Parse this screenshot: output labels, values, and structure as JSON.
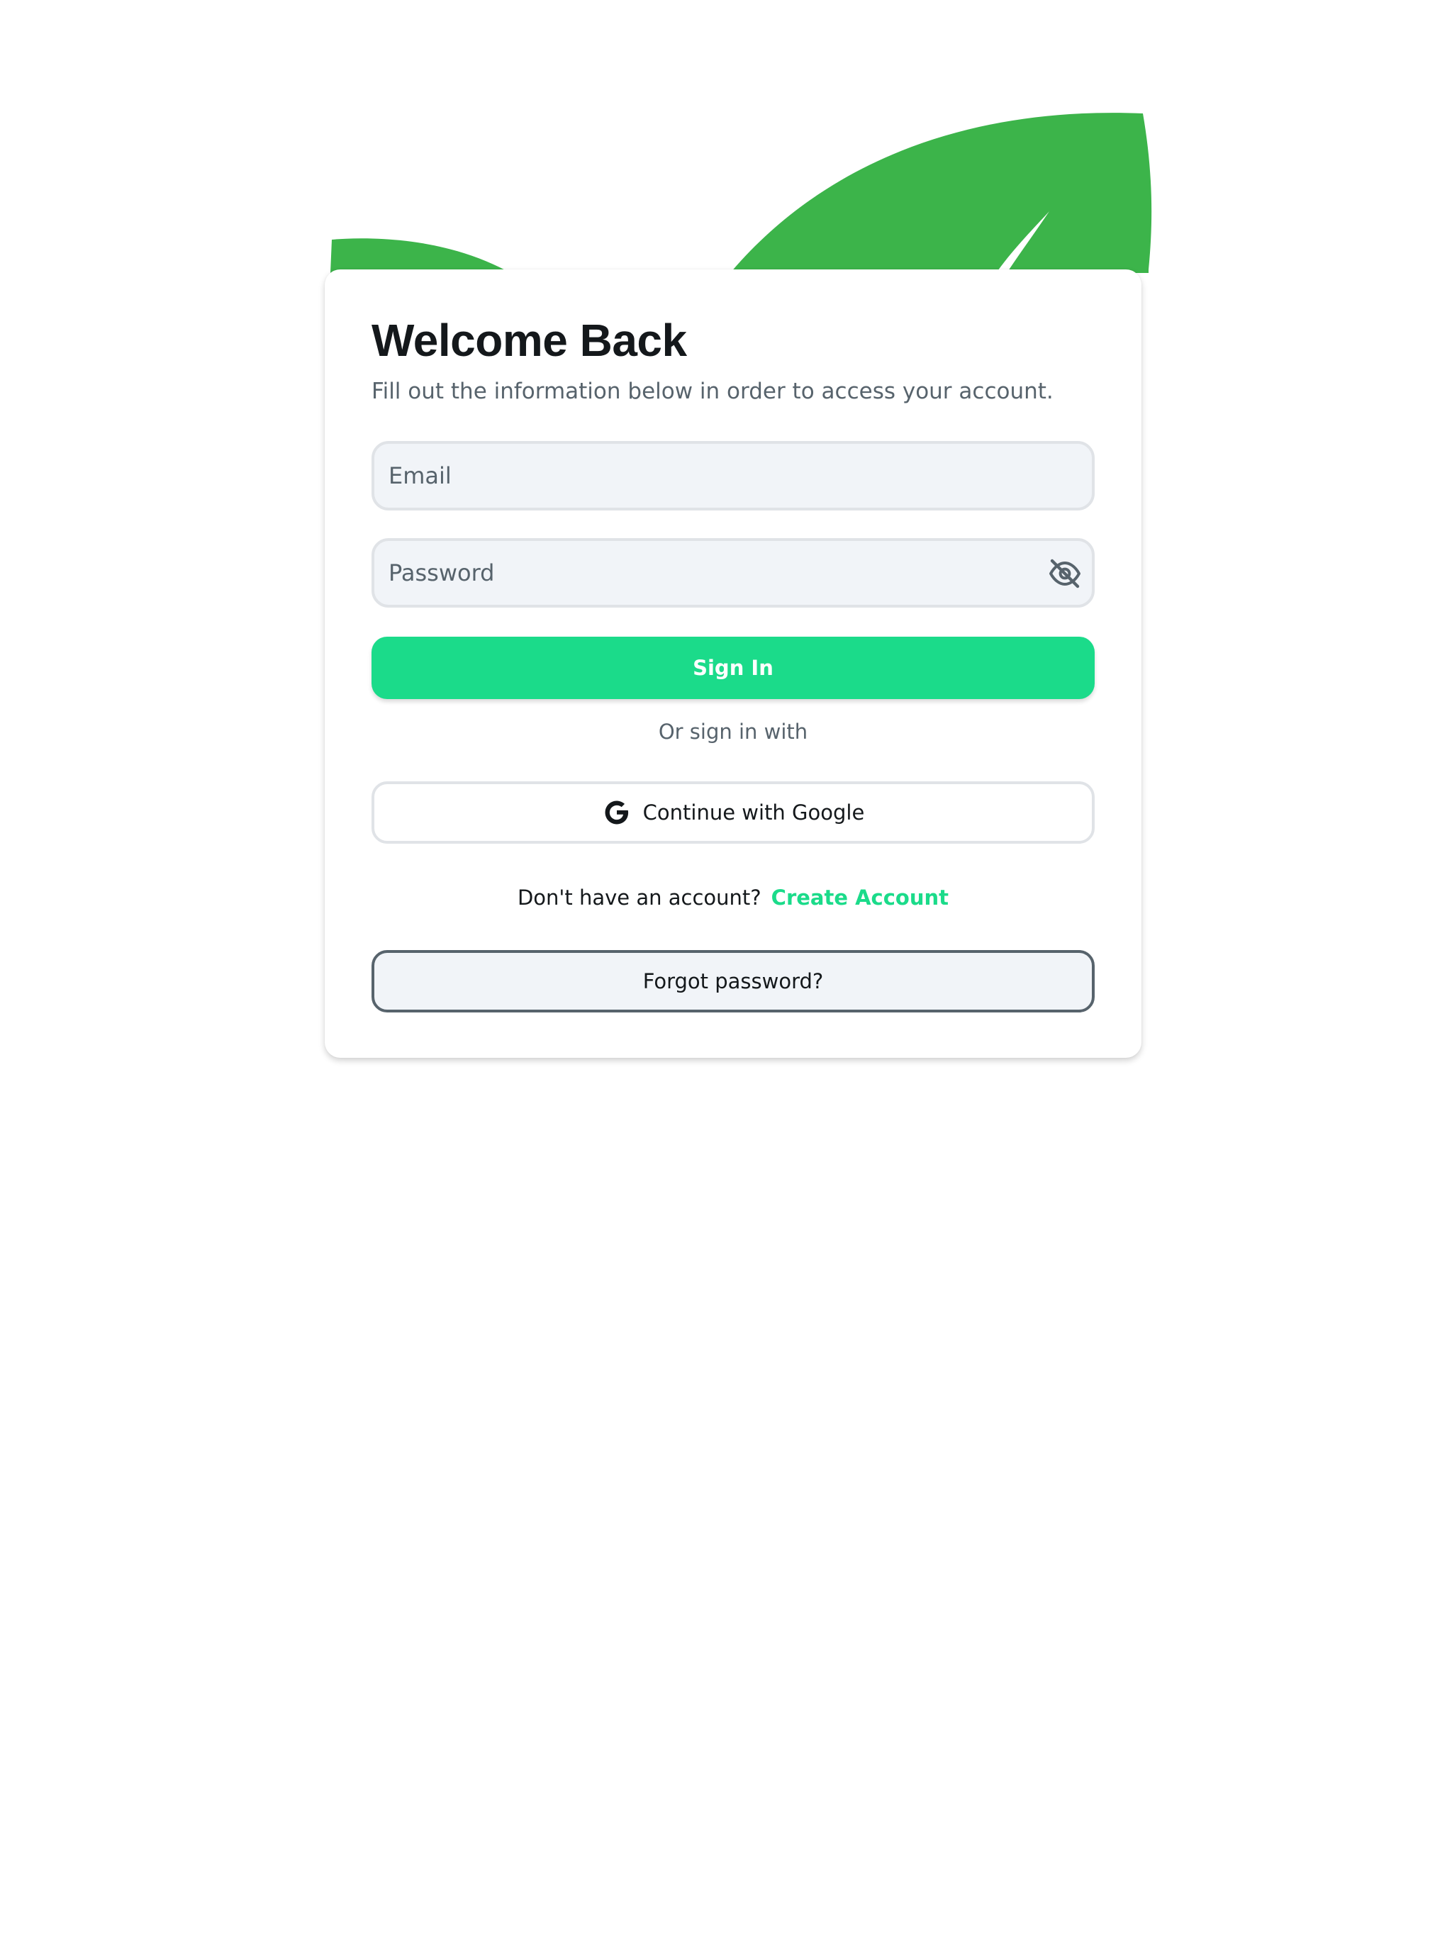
{
  "header": {
    "title": "Welcome Back",
    "subtitle": "Fill out the information below in order to access your account."
  },
  "form": {
    "email": {
      "value": "",
      "placeholder": "Email"
    },
    "password": {
      "value": "",
      "placeholder": "Password",
      "visibility_icon": "eye-off-icon"
    }
  },
  "actions": {
    "sign_in_label": "Sign In",
    "or_text": "Or sign in with",
    "google_label": "Continue with Google",
    "google_icon": "google-g-icon",
    "no_account_text": "Don't have an account?",
    "create_account_label": "Create Account",
    "forgot_password_label": "Forgot password?"
  },
  "decoration": {
    "background_icon": "leaf-icon"
  },
  "colors": {
    "accent": "#1bdb8a",
    "leaf": "#3cb44a",
    "primary_text": "#14181b",
    "secondary_text": "#57636c",
    "field_background": "#f1f4f8",
    "field_border": "#e0e3e7"
  }
}
